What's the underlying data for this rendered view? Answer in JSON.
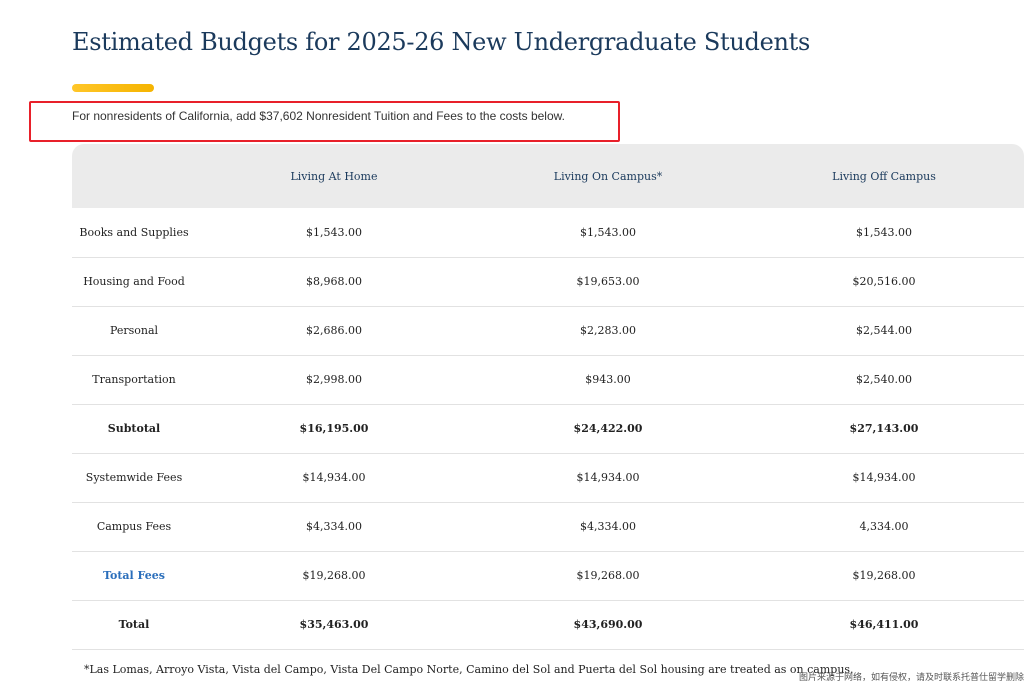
{
  "page": {
    "title": "Estimated Budgets for 2025-26 New Undergraduate Students",
    "notice": "For nonresidents of California, add $37,602 Nonresident Tuition and Fees to the costs below.",
    "footnote": "*Las Lomas, Arroyo Vista, Vista del Campo, Vista Del Campo Norte, Camino del Sol and Puerta del Sol housing are treated as on campus.",
    "watermark": "图片来源于网络，如有侵权，请及时联系托普仕留学删除"
  },
  "colors": {
    "accent_bar": "#ffc629",
    "highlight_box": "#e8202a",
    "link": "#2a6ebb",
    "header_bg": "#ebebeb"
  },
  "table": {
    "headers": [
      "",
      "Living At Home",
      "Living On Campus*",
      "Living Off Campus"
    ],
    "rows": [
      {
        "label": "Books and Supplies",
        "values": [
          "$1,543.00",
          "$1,543.00",
          "$1,543.00"
        ]
      },
      {
        "label": "Housing and Food",
        "values": [
          "$8,968.00",
          "$19,653.00",
          "$20,516.00"
        ]
      },
      {
        "label": "Personal",
        "values": [
          "$2,686.00",
          "$2,283.00",
          "$2,544.00"
        ]
      },
      {
        "label": "Transportation",
        "values": [
          "$2,998.00",
          "$943.00",
          "$2,540.00"
        ]
      },
      {
        "label": "Subtotal",
        "values": [
          "$16,195.00",
          "$24,422.00",
          "$27,143.00"
        ]
      },
      {
        "label": "Systemwide Fees",
        "values": [
          "$14,934.00",
          "$14,934.00",
          "$14,934.00"
        ]
      },
      {
        "label": "Campus Fees",
        "values": [
          "$4,334.00",
          "$4,334.00",
          "4,334.00"
        ]
      },
      {
        "label": "Total Fees",
        "values": [
          "$19,268.00",
          "$19,268.00",
          "$19,268.00"
        ]
      },
      {
        "label": "Total",
        "values": [
          "$35,463.00",
          "$43,690.00",
          "$46,411.00"
        ]
      }
    ]
  }
}
